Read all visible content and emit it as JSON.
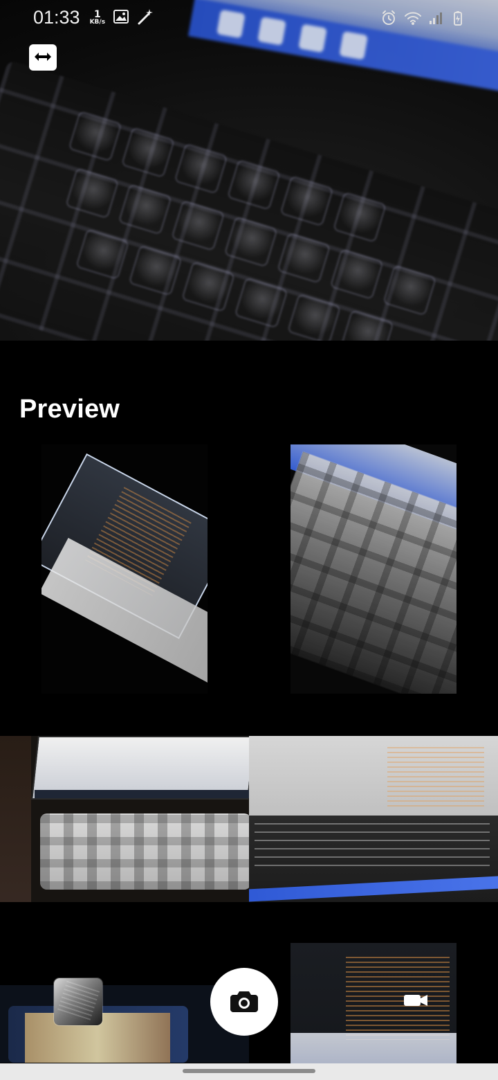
{
  "status_bar": {
    "time": "01:33",
    "net_speed_value": "1",
    "net_speed_unit": "KB/s",
    "icons": [
      "image-icon",
      "magic-wand-icon",
      "alarm-icon",
      "wifi-icon",
      "signal-icon",
      "battery-charging-icon"
    ]
  },
  "camera": {
    "switch_icon": "switch-camera-icon"
  },
  "preview": {
    "title": "Preview",
    "thumbnails": [
      "thumbnail",
      "thumbnail",
      "thumbnail",
      "thumbnail",
      "thumbnail",
      "thumbnail"
    ]
  },
  "controls": {
    "shutter_icon": "camera-icon",
    "video_icon": "video-camera-icon",
    "last_capture_icon": "last-capture-thumbnail"
  },
  "colors": {
    "background": "#000000",
    "accent": "#ffffff"
  }
}
